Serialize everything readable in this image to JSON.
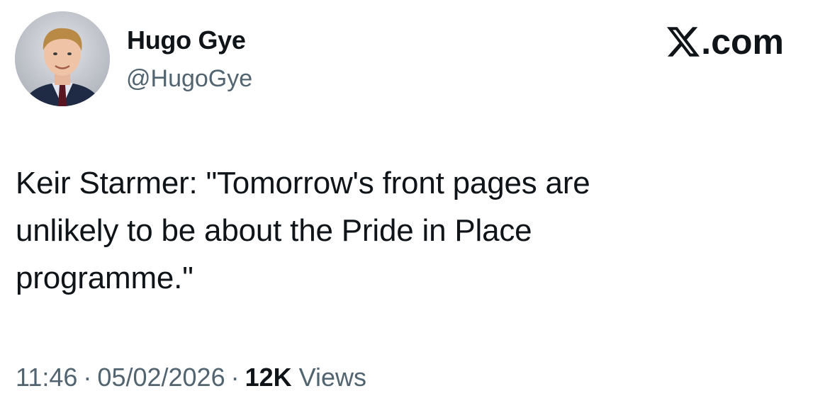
{
  "author": {
    "display_name": "Hugo Gye",
    "handle": "@HugoGye",
    "avatar_icon": "person-photo-avatar"
  },
  "brand": {
    "logo_icon": "x-logo-icon",
    "label": ".com"
  },
  "tweet": {
    "text": "Keir Starmer: \"Tomorrow's front pages are\nunlikely to be about the Pride in Place\nprogramme.\""
  },
  "meta": {
    "time": "11:46",
    "separator": "·",
    "date": "05/02/2026",
    "views_count": "12K",
    "views_label": "Views"
  },
  "colors": {
    "text_primary": "#0f1419",
    "text_secondary": "#536471",
    "background": "#ffffff"
  }
}
